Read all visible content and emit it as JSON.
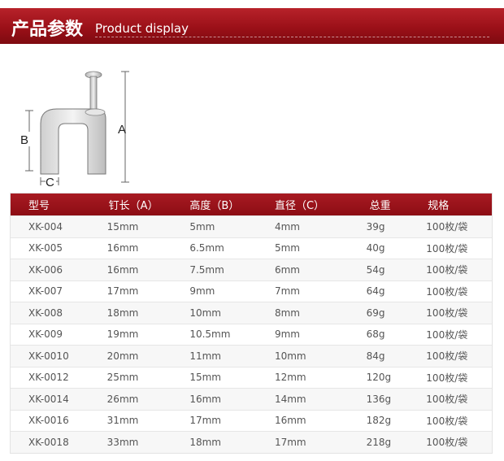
{
  "banner": {
    "title_cn": "产品参数",
    "title_en": "Product display"
  },
  "diagram": {
    "label_a": "A",
    "label_b": "B",
    "label_c": "C"
  },
  "table": {
    "headers": [
      "型号",
      "钉长（A）",
      "高度（B）",
      "直径（C）",
      "总重",
      "规格"
    ],
    "rows": [
      [
        "XK-004",
        "15mm",
        "5mm",
        "4mm",
        "39g",
        "100枚/袋"
      ],
      [
        "XK-005",
        "16mm",
        "6.5mm",
        "5mm",
        "40g",
        "100枚/袋"
      ],
      [
        "XK-006",
        "16mm",
        "7.5mm",
        "6mm",
        "54g",
        "100枚/袋"
      ],
      [
        "XK-007",
        "17mm",
        "9mm",
        "7mm",
        "64g",
        "100枚/袋"
      ],
      [
        "XK-008",
        "18mm",
        "10mm",
        "8mm",
        "69g",
        "100枚/袋"
      ],
      [
        "XK-009",
        "19mm",
        "10.5mm",
        "9mm",
        "68g",
        "100枚/袋"
      ],
      [
        "XK-0010",
        "20mm",
        "11mm",
        "10mm",
        "84g",
        "100枚/袋"
      ],
      [
        "XK-0012",
        "25mm",
        "15mm",
        "12mm",
        "120g",
        "100枚/袋"
      ],
      [
        "XK-0014",
        "26mm",
        "16mm",
        "14mm",
        "136g",
        "100枚/袋"
      ],
      [
        "XK-0016",
        "31mm",
        "17mm",
        "16mm",
        "182g",
        "100枚/袋"
      ],
      [
        "XK-0018",
        "33mm",
        "18mm",
        "17mm",
        "218g",
        "100枚/袋"
      ]
    ]
  }
}
